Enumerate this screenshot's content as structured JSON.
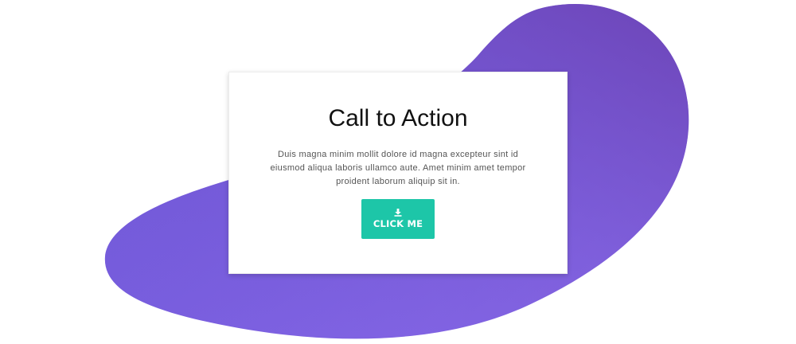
{
  "colors": {
    "blob_gradient_start": "#6d57d6",
    "blob_gradient_end": "#8a6bea",
    "blob_top_tint": "#6b44b4",
    "button_background": "#1dc6a8",
    "card_background": "#ffffff"
  },
  "card": {
    "title": "Call to Action",
    "body": "Duis magna minim mollit dolore id magna excepteur sint id eiusmod aliqua laboris ullamco aute. Amet minim amet tempor proident laborum aliquip sit in."
  },
  "cta": {
    "icon": "download-icon",
    "label": "CLICK ME"
  }
}
